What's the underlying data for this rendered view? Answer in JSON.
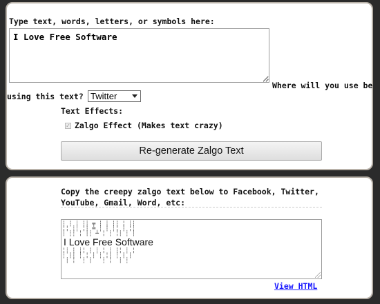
{
  "form": {
    "input_label": "Type text, words, letters, or symbols here:",
    "input_value": "I Love Free Software",
    "usage_label_part1": "Where will you use be",
    "usage_label_part2": "using this text?",
    "usage_selected": "Twitter",
    "effects_label": "Text Effects:",
    "zalgo_checkbox_label": "Zalgo Effect (Makes text crazy)",
    "zalgo_checked": true,
    "regenerate_button": "Re-generate Zalgo Text"
  },
  "output": {
    "copy_instruction_line1": "Copy the creepy zalgo text below to Facebook, Twitter,",
    "copy_instruction_line2": "YouTube, Gmail, Word, etc:",
    "zalgo_result": "I Love Free Software",
    "view_html_link": "View HTML"
  }
}
